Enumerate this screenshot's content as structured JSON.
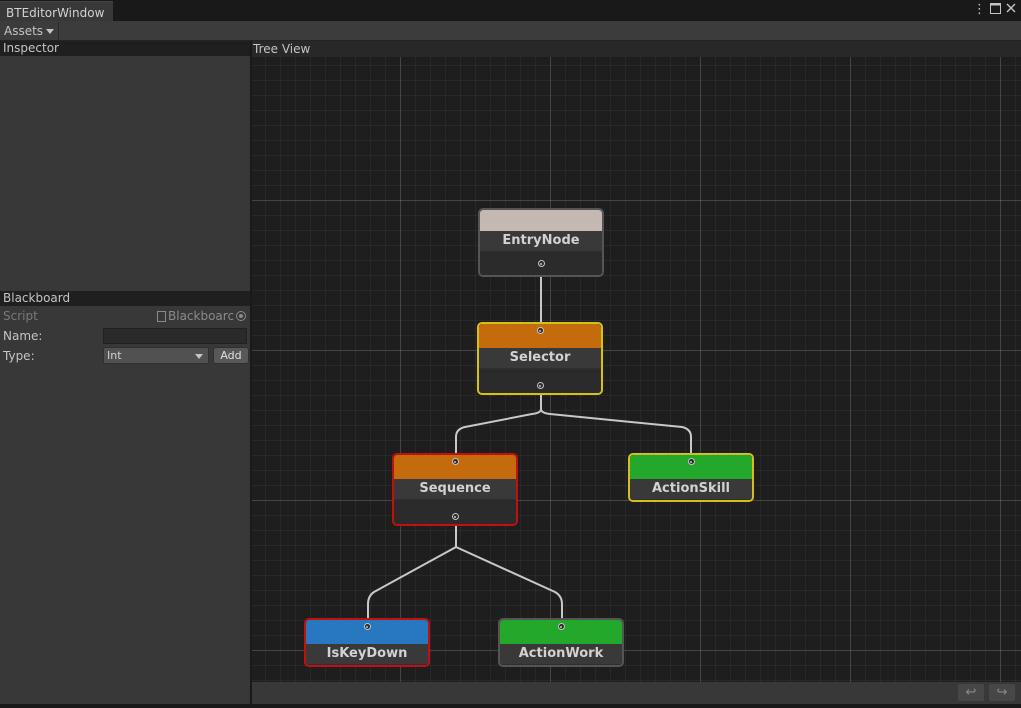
{
  "window": {
    "tab_title": "BTEditorWindow",
    "menu_icon": "kebab-menu-icon",
    "maximize_icon": "maximize-icon",
    "close_icon": "close-icon"
  },
  "toolbar": {
    "assets_label": "Assets"
  },
  "inspector": {
    "header": "Inspector"
  },
  "blackboard": {
    "header": "Blackboard",
    "script_label": "Script",
    "script_value": "Blackboarc",
    "name_label": "Name:",
    "name_value": "",
    "type_label": "Type:",
    "type_value": "Int",
    "add_label": "Add"
  },
  "tree_view": {
    "header": "Tree View",
    "nodes": {
      "entry": {
        "title": "EntryNode",
        "color": "#c5b8b3"
      },
      "selector": {
        "title": "Selector",
        "color": "#c46b0d"
      },
      "sequence": {
        "title": "Sequence",
        "color": "#c46b0d"
      },
      "action_skill": {
        "title": "ActionSkill",
        "color": "#24a82b"
      },
      "is_key_down": {
        "title": "IsKeyDown",
        "color": "#2778bf"
      },
      "action_work": {
        "title": "ActionWork",
        "color": "#24a82b"
      }
    },
    "undo_icon": "undo-icon",
    "redo_icon": "redo-icon"
  }
}
